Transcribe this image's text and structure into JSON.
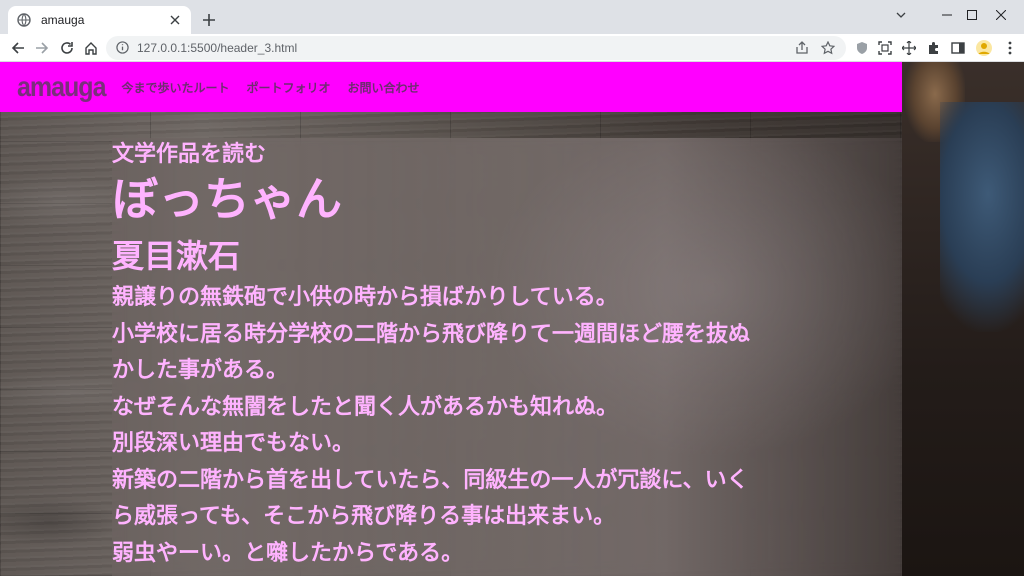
{
  "browser": {
    "tab_title": "amauga",
    "url": "127.0.0.1:5500/header_3.html"
  },
  "site": {
    "logo": "amauga",
    "nav": [
      "今まで歩いたルート",
      "ポートフォリオ",
      "お問い合わせ"
    ]
  },
  "article": {
    "subtitle": "文学作品を読む",
    "title": "ぼっちゃん",
    "author": "夏目漱石",
    "lines": [
      "親譲りの無鉄砲で小供の時から損ばかりしている。",
      "小学校に居る時分学校の二階から飛び降りて一週間ほど腰を抜ぬ",
      "かした事がある。",
      "なぜそんな無闇をしたと聞く人があるかも知れぬ。",
      "別段深い理由でもない。",
      "新築の二階から首を出していたら、同級生の一人が冗談に、いく",
      "ら威張っても、そこから飛び降りる事は出来まい。",
      "弱虫やーい。と囃したからである。"
    ]
  },
  "colors": {
    "header_bg": "#ff00ff",
    "logo": "#7a2f7c",
    "nav_text": "#6f2c71",
    "article_text": "#ffb3ff"
  },
  "icons": [
    "globe-icon",
    "close-icon",
    "plus-icon",
    "back-icon",
    "forward-icon",
    "reload-icon",
    "home-icon",
    "info-icon",
    "share-icon",
    "star-icon",
    "shield-icon",
    "screenshot-icon",
    "move-icon",
    "puzzle-icon",
    "sidebar-icon",
    "profile-icon",
    "menu-icon",
    "chevron-down-icon",
    "minimize-icon",
    "maximize-icon"
  ]
}
